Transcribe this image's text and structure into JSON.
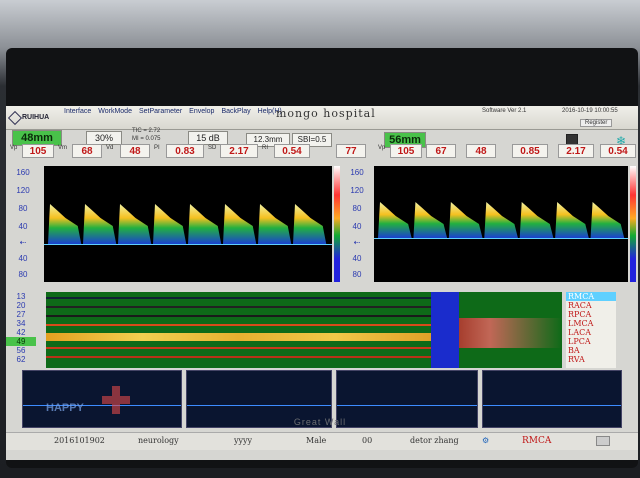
{
  "app": {
    "logo": "RUIHUA",
    "hospital": "mongo hospital",
    "software_version": "Software Ver 2.1",
    "clock": "2016-10-19 10:00:55",
    "register": "Register"
  },
  "menu": [
    "Interface",
    "WorkMode",
    "SetParameter",
    "Envelop",
    "BackPlay",
    "Help(H)"
  ],
  "params": {
    "left_depth": "48mm",
    "power": "30%",
    "tic": "TIC = 2.72",
    "mi": "MI = 0.075",
    "gain": "15 dB",
    "sample_volume": "12.3mm",
    "sbi": "SBI=0.5",
    "right_depth": "56mm"
  },
  "left_values": {
    "vp": "105",
    "vm": "68",
    "vd": "48",
    "pi": "0.83",
    "sd": "2.17",
    "ri": "0.54",
    "hr": "77"
  },
  "right_values": {
    "vp": "105",
    "vm": "67",
    "vd": "48",
    "pi": "0.85",
    "sd": "2.17",
    "ri": "0.54"
  },
  "value_labels": {
    "vp": "Vp",
    "vm": "Vm",
    "vd": "Vd",
    "pi": "PI",
    "sd": "SD",
    "ri": "RI",
    "unit": "cm/s"
  },
  "scale": [
    "160",
    "120",
    "80",
    "40",
    "",
    "40",
    "80"
  ],
  "mmode_depths": [
    "13",
    "20",
    "27",
    "34",
    "42",
    "49",
    "56",
    "62"
  ],
  "vessels": [
    "RMCA",
    "RACA",
    "RPCA",
    "LMCA",
    "LACA",
    "LPCA",
    "BA",
    "RVA"
  ],
  "patient": {
    "id": "2016101902",
    "department": "neurology",
    "name": "yyyy",
    "sex": "Male",
    "age": "00",
    "doctor": "detor zhang",
    "vessel": "RMCA"
  },
  "watermark": "HAPPY",
  "monitor_brand": "Great Wall",
  "colors": {
    "value_red": "#c01818",
    "scale_blue": "#2b3ab0",
    "green_box": "#49c24a",
    "mmode_green": "#0e6a18"
  }
}
